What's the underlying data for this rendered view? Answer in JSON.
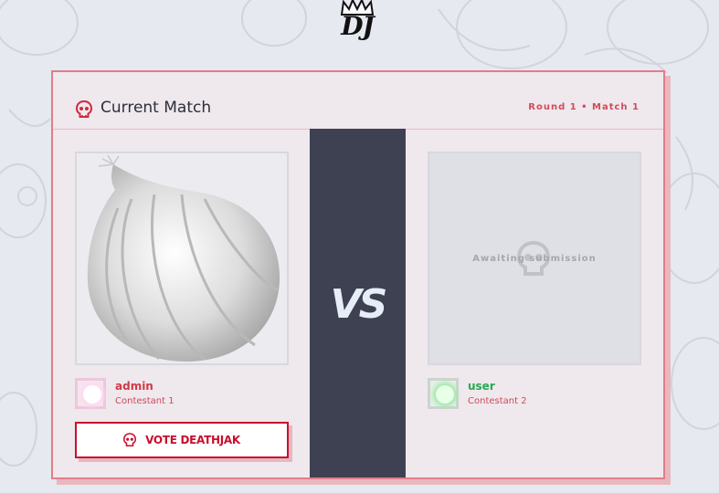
{
  "logo": {
    "text": "DJ"
  },
  "card": {
    "icon": "skull-icon",
    "title": "Current Match",
    "round_info": "Round 1 • Match 1"
  },
  "vs_label": "VS",
  "contestants": [
    {
      "name": "admin",
      "role": "Contestant 1",
      "submission": "onion-image",
      "avatar_color": "#ecc7db"
    },
    {
      "name": "user",
      "role": "Contestant 2",
      "submission_status": "Awaiting submission",
      "avatar_color": "#2aa853"
    }
  ],
  "vote_button": {
    "label": "VOTE DEATHJAK",
    "icon": "skull-icon"
  },
  "colors": {
    "accent": "#c8102e",
    "card_border": "#e07d8a",
    "vs_bg": "#3e4152",
    "user_green": "#2aa853"
  }
}
